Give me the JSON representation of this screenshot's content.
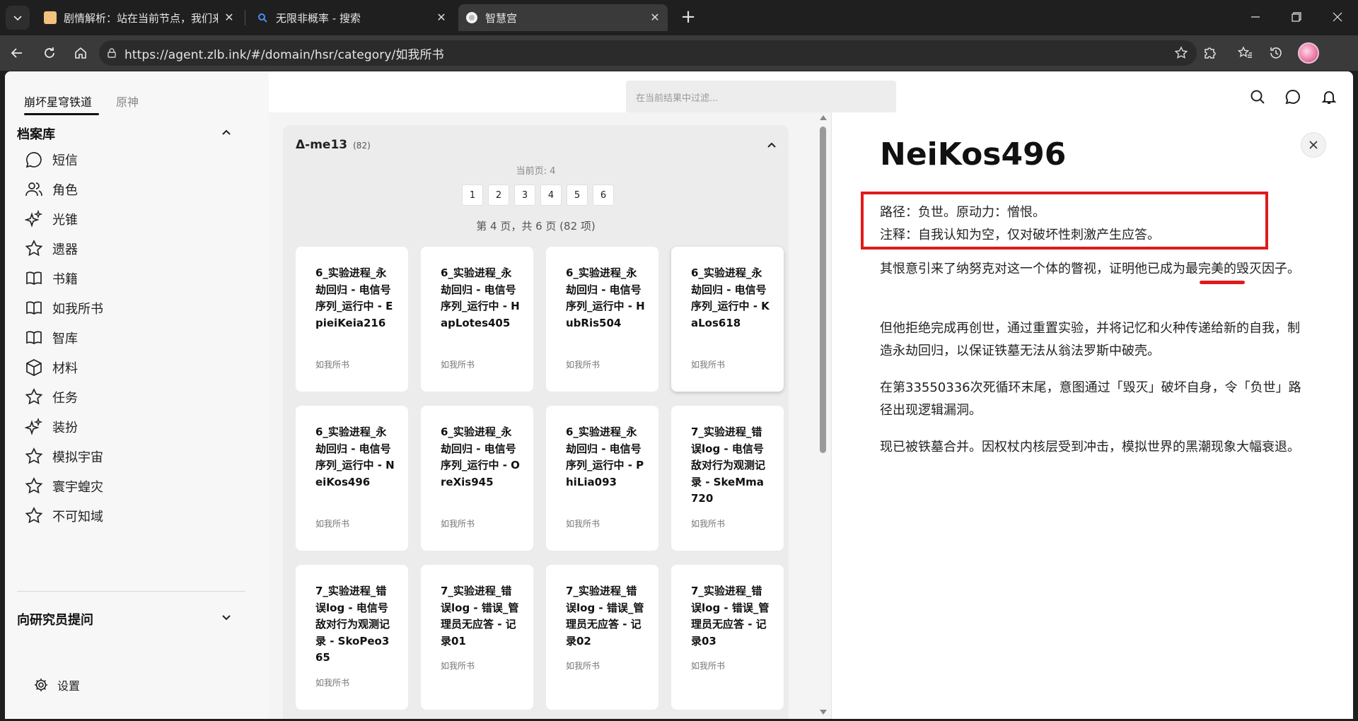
{
  "browser": {
    "tabs": [
      {
        "title": "剧情解析：站在当前节点，我们来",
        "active": false
      },
      {
        "title": "无限非概率 - 搜索",
        "active": false
      },
      {
        "title": "智慧宫",
        "active": true
      }
    ],
    "url": "https://agent.zlb.ink/#/domain/hsr/category/如我所书"
  },
  "sidebar": {
    "game_tabs": [
      "崩坏星穹铁道",
      "原神"
    ],
    "archive_title": "档案库",
    "items": [
      {
        "label": "短信",
        "icon": "message-icon"
      },
      {
        "label": "角色",
        "icon": "users-icon"
      },
      {
        "label": "光锥",
        "icon": "sparkles-icon"
      },
      {
        "label": "遗器",
        "icon": "star-icon"
      },
      {
        "label": "书籍",
        "icon": "book-icon"
      },
      {
        "label": "如我所书",
        "icon": "book-icon"
      },
      {
        "label": "智库",
        "icon": "book-icon"
      },
      {
        "label": "材料",
        "icon": "cube-icon"
      },
      {
        "label": "任务",
        "icon": "star-icon"
      },
      {
        "label": "装扮",
        "icon": "sparkles-icon"
      },
      {
        "label": "模拟宇宙",
        "icon": "star-icon"
      },
      {
        "label": "寰宇蝗灾",
        "icon": "star-icon"
      },
      {
        "label": "不可知域",
        "icon": "star-icon"
      }
    ],
    "ask_title": "向研究员提问",
    "settings_label": "设置"
  },
  "header": {
    "filter_placeholder": "在当前结果中过滤..."
  },
  "group": {
    "title": "Δ-me13",
    "count": "(82)",
    "current_page": "当前页: 4",
    "pages": [
      "1",
      "2",
      "3",
      "4",
      "5",
      "6"
    ],
    "summary": "第 4 页，共 6 页 (82 项)",
    "cards": [
      {
        "title": "6_实验进程_永劫回归 - 电信号序列_运行中 - EpieiKeia216",
        "category": "如我所书"
      },
      {
        "title": "6_实验进程_永劫回归 - 电信号序列_运行中 - HapLotes405",
        "category": "如我所书"
      },
      {
        "title": "6_实验进程_永劫回归 - 电信号序列_运行中 - HubRis504",
        "category": "如我所书"
      },
      {
        "title": "6_实验进程_永劫回归 - 电信号序列_运行中 - KaLos618",
        "category": "如我所书"
      },
      {
        "title": "6_实验进程_永劫回归 - 电信号序列_运行中 - NeiKos496",
        "category": "如我所书"
      },
      {
        "title": "6_实验进程_永劫回归 - 电信号序列_运行中 - OreXis945",
        "category": "如我所书"
      },
      {
        "title": "6_实验进程_永劫回归 - 电信号序列_运行中 - PhiLia093",
        "category": "如我所书"
      },
      {
        "title": "7_实验进程_错误log - 电信号敌对行为观测记录 - SkeMma720",
        "category": "如我所书"
      },
      {
        "title": "7_实验进程_错误log - 电信号敌对行为观测记录 - SkoPeo365",
        "category": "如我所书"
      },
      {
        "title": "7_实验进程_错误log - 错误_管理员无应答 - 记录01",
        "category": "如我所书"
      },
      {
        "title": "7_实验进程_错误log - 错误_管理员无应答 - 记录02",
        "category": "如我所书"
      },
      {
        "title": "7_实验进程_错误log - 错误_管理员无应答 - 记录03",
        "category": "如我所书"
      }
    ]
  },
  "detail": {
    "title": "NeiKos496",
    "line1": "路径：负世。原动力：憎恨。",
    "line2": "注释：自我认知为空，仅对破坏性刺激产生应答。",
    "para1": "其恨意引来了纳努克对这一个体的瞥视，证明他已成为最完美的毁灭因子。",
    "para2": "但他拒绝完成再创世，通过重置实验，并将记忆和火种传递给新的自我，制造永劫回归，以保证铁墓无法从翁法罗斯中破壳。",
    "para3": "在第33550336次死循环末尾，意图通过「毁灭」破坏自身，令「负世」路径出现逻辑漏洞。",
    "para4": "现已被铁墓合并。因权杖内核层受到冲击，模拟世界的黑潮现象大幅衰退。"
  },
  "colors": {
    "highlight_red": "#e01a1a"
  }
}
